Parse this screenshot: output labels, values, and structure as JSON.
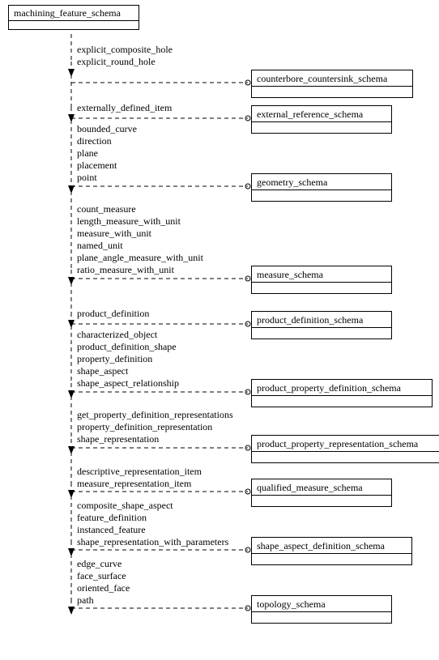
{
  "source": {
    "title": "machining_feature_schema"
  },
  "groups": [
    {
      "labels": [
        "explicit_composite_hole",
        "explicit_round_hole"
      ],
      "target": "counterbore_countersink_schema",
      "labelTop": 54,
      "arrowY": 86,
      "targetTop": 86,
      "targetHeight": 32,
      "targetLeft": 310,
      "targetWidth": 186
    },
    {
      "labels": [
        "externally_defined_item"
      ],
      "target": "external_reference_schema",
      "labelTop": 126,
      "arrowY": 142,
      "targetTop": 130,
      "targetHeight": 32,
      "targetLeft": 310,
      "targetWidth": 160
    },
    {
      "labels": [
        "bounded_curve",
        "direction",
        "plane",
        "placement",
        "point"
      ],
      "target": "geometry_schema",
      "labelTop": 152,
      "arrowY": 230,
      "targetTop": 214,
      "targetHeight": 32,
      "targetLeft": 310,
      "targetWidth": 160
    },
    {
      "labels": [
        "count_measure",
        "length_measure_with_unit",
        "measure_with_unit",
        "named_unit",
        "plane_angle_measure_with_unit",
        "ratio_measure_with_unit"
      ],
      "target": "measure_schema",
      "labelTop": 251,
      "arrowY": 343,
      "targetTop": 328,
      "targetHeight": 32,
      "targetLeft": 310,
      "targetWidth": 160
    },
    {
      "labels": [
        "product_definition"
      ],
      "target": "product_definition_schema",
      "labelTop": 380,
      "arrowY": 396,
      "targetTop": 384,
      "targetHeight": 32,
      "targetLeft": 310,
      "targetWidth": 160
    },
    {
      "labels": [
        "characterized_object",
        "product_definition_shape",
        "property_definition",
        "shape_aspect",
        "shape_aspect_relationship"
      ],
      "target": "product_property_definition_schema",
      "labelTop": 406,
      "arrowY": 483,
      "targetTop": 468,
      "targetHeight": 32,
      "targetLeft": 310,
      "targetWidth": 210
    },
    {
      "labels": [
        "get_property_definition_representations",
        "property_definition_representation",
        "shape_representation"
      ],
      "target": "product_property_representation_schema",
      "labelTop": 505,
      "arrowY": 552,
      "targetTop": 537,
      "targetHeight": 32,
      "targetLeft": 310,
      "targetWidth": 225
    },
    {
      "labels": [
        "descriptive_representation_item",
        "measure_representation_item"
      ],
      "target": "qualified_measure_schema",
      "labelTop": 575,
      "arrowY": 606,
      "targetTop": 591,
      "targetHeight": 32,
      "targetLeft": 310,
      "targetWidth": 160
    },
    {
      "labels": [
        "composite_shape_aspect",
        "feature_definition",
        "instanced_feature",
        "shape_representation_with_parameters"
      ],
      "target": "shape_aspect_definition_schema",
      "labelTop": 617,
      "arrowY": 678,
      "targetTop": 663,
      "targetHeight": 32,
      "targetLeft": 310,
      "targetWidth": 185
    },
    {
      "labels": [
        "edge_curve",
        "face_surface",
        "oriented_face",
        "path"
      ],
      "target": "topology_schema",
      "labelTop": 689,
      "arrowY": 750,
      "targetTop": 735,
      "targetHeight": 32,
      "targetLeft": 310,
      "targetWidth": 160
    }
  ],
  "layout": {
    "sourceLeft": 10,
    "sourceTop": 6,
    "sourceWidth": 160,
    "trunkX": 88,
    "labelX": 95
  }
}
